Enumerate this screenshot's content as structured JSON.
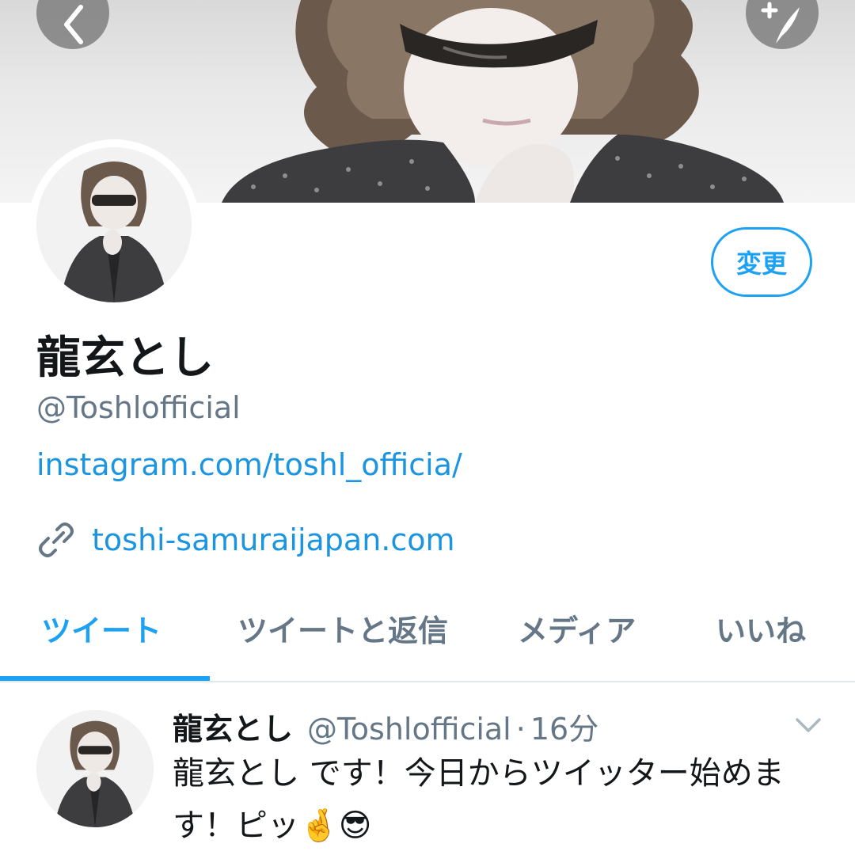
{
  "header": {
    "back_icon": "chevron-left-icon",
    "compose_icon": "compose-tweet-icon"
  },
  "profile": {
    "edit_label": "変更",
    "display_name": "龍玄とし",
    "handle": "@Toshlofficial",
    "bio_link": "instagram.com/toshl_officia/",
    "website": "toshi-samuraijapan.com",
    "website_icon": "link-icon"
  },
  "tabs": [
    {
      "label": "ツイート",
      "active": true
    },
    {
      "label": "ツイートと返信",
      "active": false
    },
    {
      "label": "メディア",
      "active": false
    },
    {
      "label": "いいね",
      "active": false
    }
  ],
  "tweet": {
    "name": "龍玄とし",
    "handle": "@Toshlofficial",
    "separator": "·",
    "time": "16分",
    "text": "龍玄とし です！今日からツイッター始めます！ピッ🤞😎",
    "menu_icon": "chevron-down-icon"
  },
  "colors": {
    "accent": "#1da1f2",
    "link": "#1b95e0",
    "secondary_text": "#657786",
    "primary_text": "#14171a",
    "divider": "#e1e8ed"
  }
}
